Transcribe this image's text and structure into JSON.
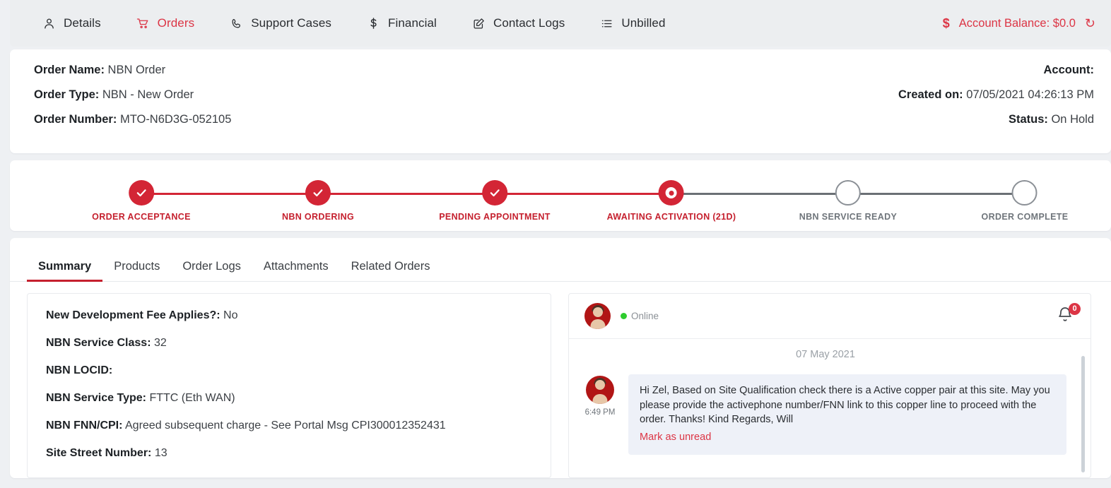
{
  "topnav": {
    "items": [
      {
        "label": "Details",
        "icon": "user-icon",
        "active": false
      },
      {
        "label": "Orders",
        "icon": "cart-icon",
        "active": true
      },
      {
        "label": "Support Cases",
        "icon": "phone-icon",
        "active": false
      },
      {
        "label": "Financial",
        "icon": "dollar-icon",
        "active": false
      },
      {
        "label": "Contact Logs",
        "icon": "edit-square-icon",
        "active": false
      },
      {
        "label": "Unbilled",
        "icon": "list-icon",
        "active": false
      }
    ],
    "balance_label": "Account Balance: $0.0",
    "balance_currency_icon": "dollar-icon",
    "refresh_icon": "refresh-icon",
    "accent_color": "#dc3545"
  },
  "order_info": {
    "left": [
      {
        "label": "Order Name:",
        "value": "NBN Order"
      },
      {
        "label": "Order Type:",
        "value": "NBN - New Order"
      },
      {
        "label": "Order Number:",
        "value": "MTO-N6D3G-052105"
      }
    ],
    "right": [
      {
        "label": "Account:",
        "value": ""
      },
      {
        "label": "Created on:",
        "value": "07/05/2021 04:26:13 PM"
      },
      {
        "label": "Status:",
        "value": "On Hold"
      }
    ]
  },
  "stepper": {
    "steps": [
      {
        "label": "ORDER ACCEPTANCE",
        "state": "done"
      },
      {
        "label": "NBN ORDERING",
        "state": "done"
      },
      {
        "label": "PENDING APPOINTMENT",
        "state": "done"
      },
      {
        "label": "AWAITING ACTIVATION (21D)",
        "state": "current"
      },
      {
        "label": "NBN SERVICE READY",
        "state": "todo"
      },
      {
        "label": "ORDER COMPLETE",
        "state": "todo"
      }
    ],
    "completed_color": "#d32535",
    "pending_color": "#6b7075"
  },
  "tabs": [
    {
      "label": "Summary",
      "active": true
    },
    {
      "label": "Products",
      "active": false
    },
    {
      "label": "Order Logs",
      "active": false
    },
    {
      "label": "Attachments",
      "active": false
    },
    {
      "label": "Related Orders",
      "active": false
    }
  ],
  "summary": {
    "rows": [
      {
        "label": "New Development Fee Applies?:",
        "value": "No"
      },
      {
        "label": "NBN Service Class:",
        "value": "32"
      },
      {
        "label": "NBN LOCID:",
        "value": ""
      },
      {
        "label": "NBN Service Type:",
        "value": "FTTC (Eth WAN)"
      },
      {
        "label": "NBN FNN/CPI:",
        "value": "Agreed subsequent charge - See Portal Msg CPI300012352431"
      },
      {
        "label": "Site Street Number:",
        "value": "13"
      }
    ]
  },
  "chat": {
    "status": "Online",
    "avatar": "user-avatar",
    "bell_icon": "bell-icon",
    "badge_count": "0",
    "date_divider": "07 May 2021",
    "messages": [
      {
        "time": "6:49 PM",
        "text": "Hi Zel, Based on Site Qualification check there is a Active copper pair at this site. May you please provide the activephone number/FNN link to this copper line to proceed with the order. Thanks! Kind Regards, Will",
        "action": "Mark as unread"
      }
    ]
  }
}
